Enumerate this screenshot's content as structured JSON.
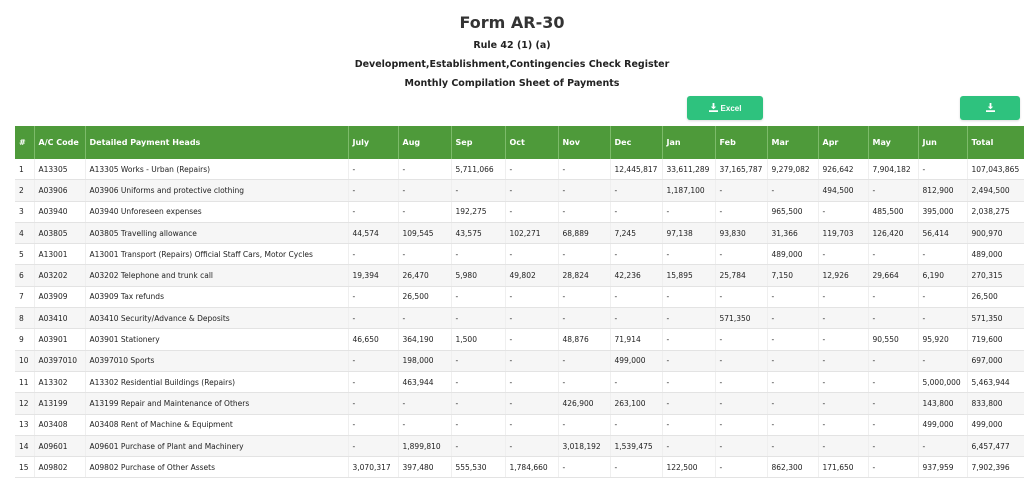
{
  "header": {
    "title": "Form AR-30",
    "rule": "Rule 42 (1) (a)",
    "register": "Development,Establishment,Contingencies Check Register",
    "sheet": "Monthly Compilation Sheet of Payments"
  },
  "buttons": {
    "excel_label": "Excel",
    "excel_icon": "download-icon",
    "download_icon": "download-icon",
    "color": "#2ec27e"
  },
  "colors": {
    "header_bg": "#4e9a3a",
    "header_text": "#ffffff"
  },
  "table": {
    "headers": [
      "#",
      "A/C Code",
      "Detailed Payment Heads",
      "July",
      "Aug",
      "Sep",
      "Oct",
      "Nov",
      "Dec",
      "Jan",
      "Feb",
      "Mar",
      "Apr",
      "May",
      "Jun",
      "Total"
    ],
    "rows": [
      [
        "1",
        "A13305",
        "A13305 Works - Urban (Repairs)",
        "-",
        "-",
        "5,711,066",
        "-",
        "-",
        "12,445,817",
        "33,611,289",
        "37,165,787",
        "9,279,082",
        "926,642",
        "7,904,182",
        "-",
        "107,043,865"
      ],
      [
        "2",
        "A03906",
        "A03906 Uniforms and protective clothing",
        "-",
        "-",
        "-",
        "-",
        "-",
        "-",
        "1,187,100",
        "-",
        "-",
        "494,500",
        "-",
        "812,900",
        "2,494,500"
      ],
      [
        "3",
        "A03940",
        "A03940 Unforeseen expenses",
        "-",
        "-",
        "192,275",
        "-",
        "-",
        "-",
        "-",
        "-",
        "965,500",
        "-",
        "485,500",
        "395,000",
        "2,038,275"
      ],
      [
        "4",
        "A03805",
        "A03805 Travelling allowance",
        "44,574",
        "109,545",
        "43,575",
        "102,271",
        "68,889",
        "7,245",
        "97,138",
        "93,830",
        "31,366",
        "119,703",
        "126,420",
        "56,414",
        "900,970"
      ],
      [
        "5",
        "A13001",
        "A13001 Transport (Repairs) Official Staff Cars, Motor Cycles",
        "-",
        "-",
        "-",
        "-",
        "-",
        "-",
        "-",
        "-",
        "489,000",
        "-",
        "-",
        "-",
        "489,000"
      ],
      [
        "6",
        "A03202",
        "A03202 Telephone and trunk call",
        "19,394",
        "26,470",
        "5,980",
        "49,802",
        "28,824",
        "42,236",
        "15,895",
        "25,784",
        "7,150",
        "12,926",
        "29,664",
        "6,190",
        "270,315"
      ],
      [
        "7",
        "A03909",
        "A03909 Tax refunds",
        "-",
        "26,500",
        "-",
        "-",
        "-",
        "-",
        "-",
        "-",
        "-",
        "-",
        "-",
        "-",
        "26,500"
      ],
      [
        "8",
        "A03410",
        "A03410 Security/Advance & Deposits",
        "-",
        "-",
        "-",
        "-",
        "-",
        "-",
        "-",
        "571,350",
        "-",
        "-",
        "-",
        "-",
        "571,350"
      ],
      [
        "9",
        "A03901",
        "A03901 Stationery",
        "46,650",
        "364,190",
        "1,500",
        "-",
        "48,876",
        "71,914",
        "-",
        "-",
        "-",
        "-",
        "90,550",
        "95,920",
        "719,600"
      ],
      [
        "10",
        "A0397010",
        "A0397010 Sports",
        "-",
        "198,000",
        "-",
        "-",
        "-",
        "499,000",
        "-",
        "-",
        "-",
        "-",
        "-",
        "-",
        "697,000"
      ],
      [
        "11",
        "A13302",
        "A13302 Residential Buildings (Repairs)",
        "-",
        "463,944",
        "-",
        "-",
        "-",
        "-",
        "-",
        "-",
        "-",
        "-",
        "-",
        "5,000,000",
        "5,463,944"
      ],
      [
        "12",
        "A13199",
        "A13199 Repair and Maintenance of Others",
        "-",
        "-",
        "-",
        "-",
        "426,900",
        "263,100",
        "-",
        "-",
        "-",
        "-",
        "-",
        "143,800",
        "833,800"
      ],
      [
        "13",
        "A03408",
        "A03408 Rent of Machine & Equipment",
        "-",
        "-",
        "-",
        "-",
        "-",
        "-",
        "-",
        "-",
        "-",
        "-",
        "-",
        "499,000",
        "499,000"
      ],
      [
        "14",
        "A09601",
        "A09601 Purchase of Plant and Machinery",
        "-",
        "1,899,810",
        "-",
        "-",
        "3,018,192",
        "1,539,475",
        "-",
        "-",
        "-",
        "-",
        "-",
        "-",
        "6,457,477"
      ],
      [
        "15",
        "A09802",
        "A09802 Purchase of Other Assets",
        "3,070,317",
        "397,480",
        "555,530",
        "1,784,660",
        "-",
        "-",
        "122,500",
        "-",
        "862,300",
        "171,650",
        "-",
        "937,959",
        "7,902,396"
      ]
    ]
  }
}
